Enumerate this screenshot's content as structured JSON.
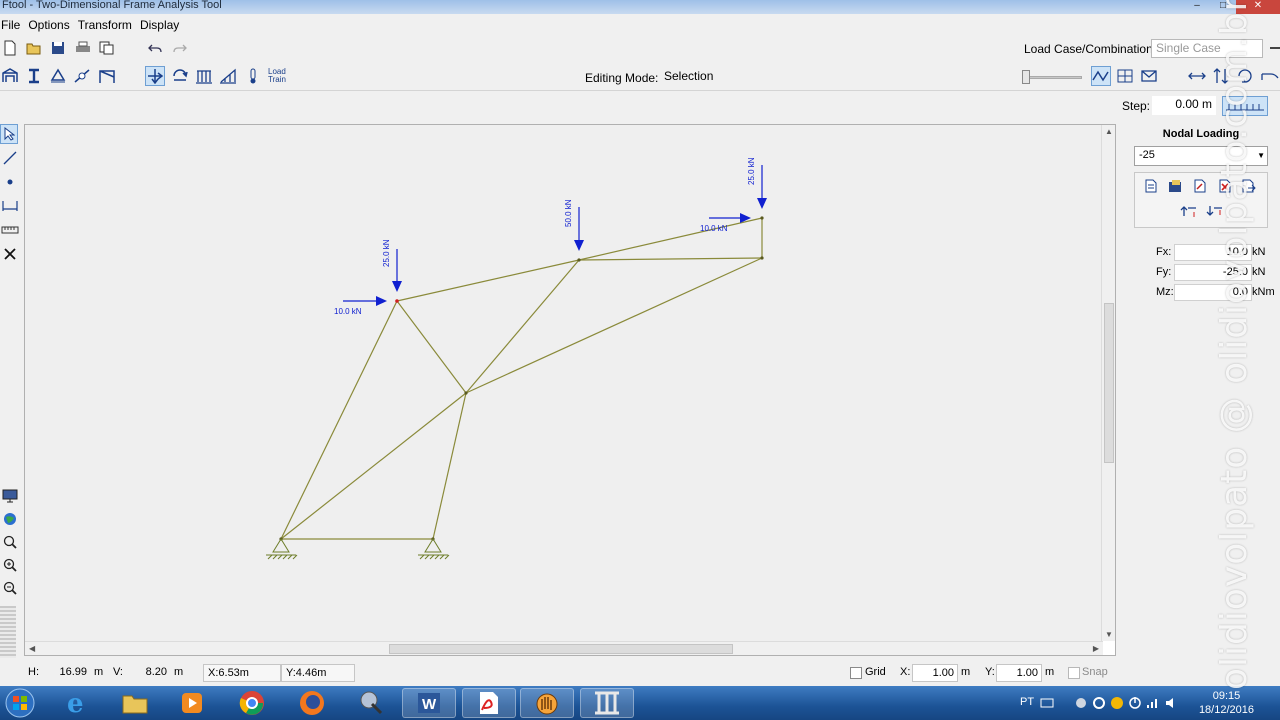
{
  "window": {
    "title": "Ftool - Two-Dimensional Frame Analysis Tool"
  },
  "menu": [
    "File",
    "Options",
    "Transform",
    "Display"
  ],
  "toolbar": {
    "load_case_label": "Load Case/Combination:",
    "load_case_value": "Single Case",
    "editing_mode_label": "Editing Mode:",
    "editing_mode_value": "Selection",
    "load_train_label": "Load\nTrain",
    "step_label": "Step:",
    "step_value": "0.00 m"
  },
  "panel": {
    "title": "Nodal Loading",
    "selected_load": "-25",
    "fx_label": "Fx:",
    "fx_value": "10.0",
    "fx_unit": "kN",
    "fy_label": "Fy:",
    "fy_value": "-25.0",
    "fy_unit": "kN",
    "mz_label": "Mz:",
    "mz_value": "0.0",
    "mz_unit": "kNm"
  },
  "loads": {
    "a_vertical": "25.0 kN",
    "a_horizontal": "10.0 kN",
    "b_vertical": "50.0 kN",
    "c_vertical": "25.0 kN",
    "c_horizontal": "10.0 kN"
  },
  "status": {
    "h_label": "H:",
    "h_value": "16.99",
    "h_unit": "m",
    "v_label": "V:",
    "v_value": "8.20",
    "v_unit": "m",
    "x_coord": "X:6.53m",
    "y_coord": "Y:4.46m",
    "grid_label": "Grid",
    "gx_label": "X:",
    "gx_value": "1.00",
    "gx_unit": "m",
    "gy_label": "Y:",
    "gy_value": "1.00",
    "gy_unit": "m",
    "snap_label": "Snap"
  },
  "taskbar": {
    "lang": "PT",
    "time": "09:15",
    "date": "18/12/2016"
  },
  "watermark": "olidiovolpato @ olidiovolpato.com.br",
  "colors": {
    "member": "#8a8a3a",
    "load": "#1020d0",
    "support": "#6e7e2a",
    "accent": "#1c5396"
  }
}
